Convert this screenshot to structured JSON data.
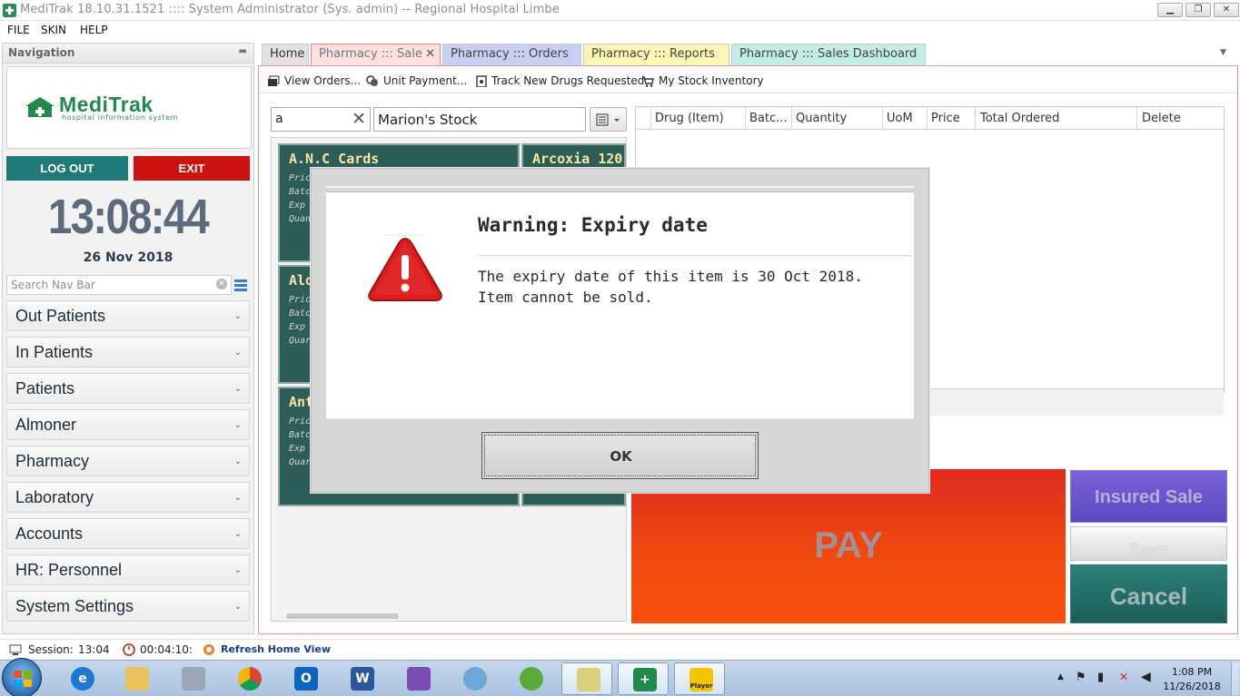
{
  "window": {
    "title": "MediTrak 18.10.31.1521 :::: System Administrator (Sys. admin) -- Regional Hospital Limbe",
    "minimize": "▁",
    "restore": "❐",
    "close": "✕"
  },
  "menubar": [
    "FILE",
    "SKIN",
    "HELP"
  ],
  "nav": {
    "header": "Navigation",
    "logo_text": "MediTrak",
    "logo_subtitle": "hospital information system",
    "logout_label": "LOG OUT",
    "exit_label": "EXIT",
    "clock": "13:08:44",
    "date": "26 Nov 2018",
    "search_placeholder": "Search Nav Bar",
    "groups": [
      "Out Patients",
      "In Patients",
      "Patients",
      "Almoner",
      "Pharmacy",
      "Laboratory",
      "Accounts",
      "HR: Personnel",
      "System Settings"
    ]
  },
  "tabs": [
    "Home",
    "Pharmacy ::: Sale",
    "Pharmacy ::: Orders",
    "Pharmacy ::: Reports",
    "Pharmacy ::: Sales Dashboard"
  ],
  "toolbar": [
    "View Orders...",
    "Unit Payment...",
    "Track New Drugs Requested",
    "My Stock Inventory"
  ],
  "sale": {
    "search_value": "a",
    "stock_value": "Marion's Stock",
    "cards": [
      {
        "name": "A.N.C Cards",
        "lines": [
          "Pric",
          "Batc",
          "Exp",
          "Quan"
        ]
      },
      {
        "name": "Arcoxia 120",
        "lines": []
      },
      {
        "name": "Alo",
        "lines": [
          "Pric",
          "Batc",
          "Exp",
          "Quar"
        ]
      },
      {
        "name": "Ant",
        "lines": [
          "Pric",
          "Batc",
          "Exp",
          "Quar"
        ]
      }
    ],
    "grid_columns": [
      "Drug (Item)",
      "Batc...",
      "Quantity",
      "UoM",
      "Price",
      "Total Ordered",
      "Delete"
    ],
    "pay_label": "PAY",
    "insured_label": "Insured Sale",
    "save_label": "Save",
    "cancel_label": "Cancel"
  },
  "dialog": {
    "title": "Warning: Expiry date",
    "message": "The expiry date of this item is 30 Oct 2018. Item cannot be sold.",
    "ok_label": "OK"
  },
  "statusbar": {
    "session_label": "Session:",
    "session_time": "13:04",
    "elapsed": "00:04:10:",
    "refresh_label": "Refresh Home View"
  },
  "taskbar": {
    "time": "1:08 PM",
    "date": "11/26/2018",
    "player_label": "Player"
  },
  "colors": {
    "logout": "#1f7b78",
    "exit": "#cc1111",
    "card": "#2e5c56",
    "pay": "#f04a10",
    "insured": "#6652cc",
    "cancel": "#22706a",
    "warning": "#d81e1e"
  }
}
